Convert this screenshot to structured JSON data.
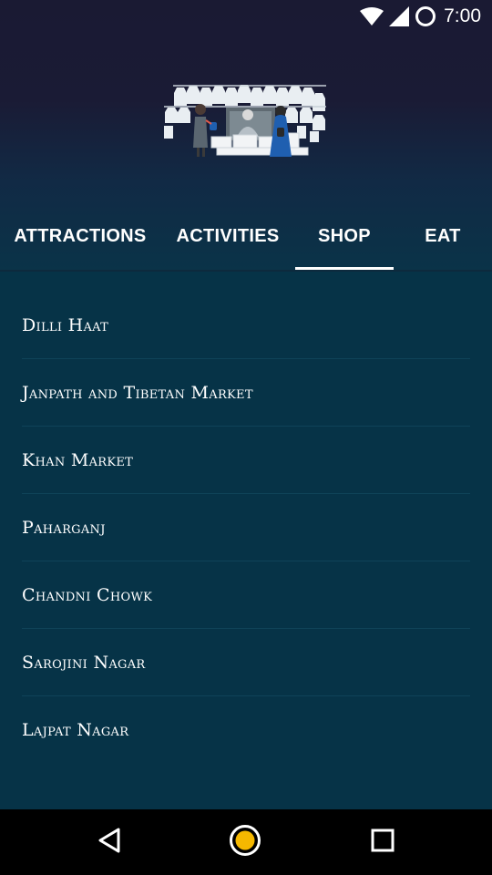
{
  "status_bar": {
    "time": "7:00",
    "icons": [
      "wifi-icon",
      "cell-signal-icon",
      "battery-ring-icon"
    ]
  },
  "header": {
    "illustration": "market-stall-illustration"
  },
  "tabs": [
    {
      "label": "ATTRACTIONS",
      "selected": false
    },
    {
      "label": "ACTIVITIES",
      "selected": false
    },
    {
      "label": "SHOP",
      "selected": true
    },
    {
      "label": "EAT",
      "selected": false
    }
  ],
  "shop_list": [
    "Dilli Haat",
    "Janpath and Tibetan Market",
    "Khan Market",
    "Paharganj",
    "Chandni Chowk",
    "Sarojini Nagar",
    "Lajpat Nagar"
  ],
  "nav_bar": {
    "buttons": [
      "back-icon",
      "home-icon",
      "recents-icon"
    ],
    "home_accent": "#f5b800"
  },
  "colors": {
    "header_top": "#1a1a33",
    "list_background": "#063347",
    "divider": "#0f4358",
    "text": "#ffffff"
  }
}
